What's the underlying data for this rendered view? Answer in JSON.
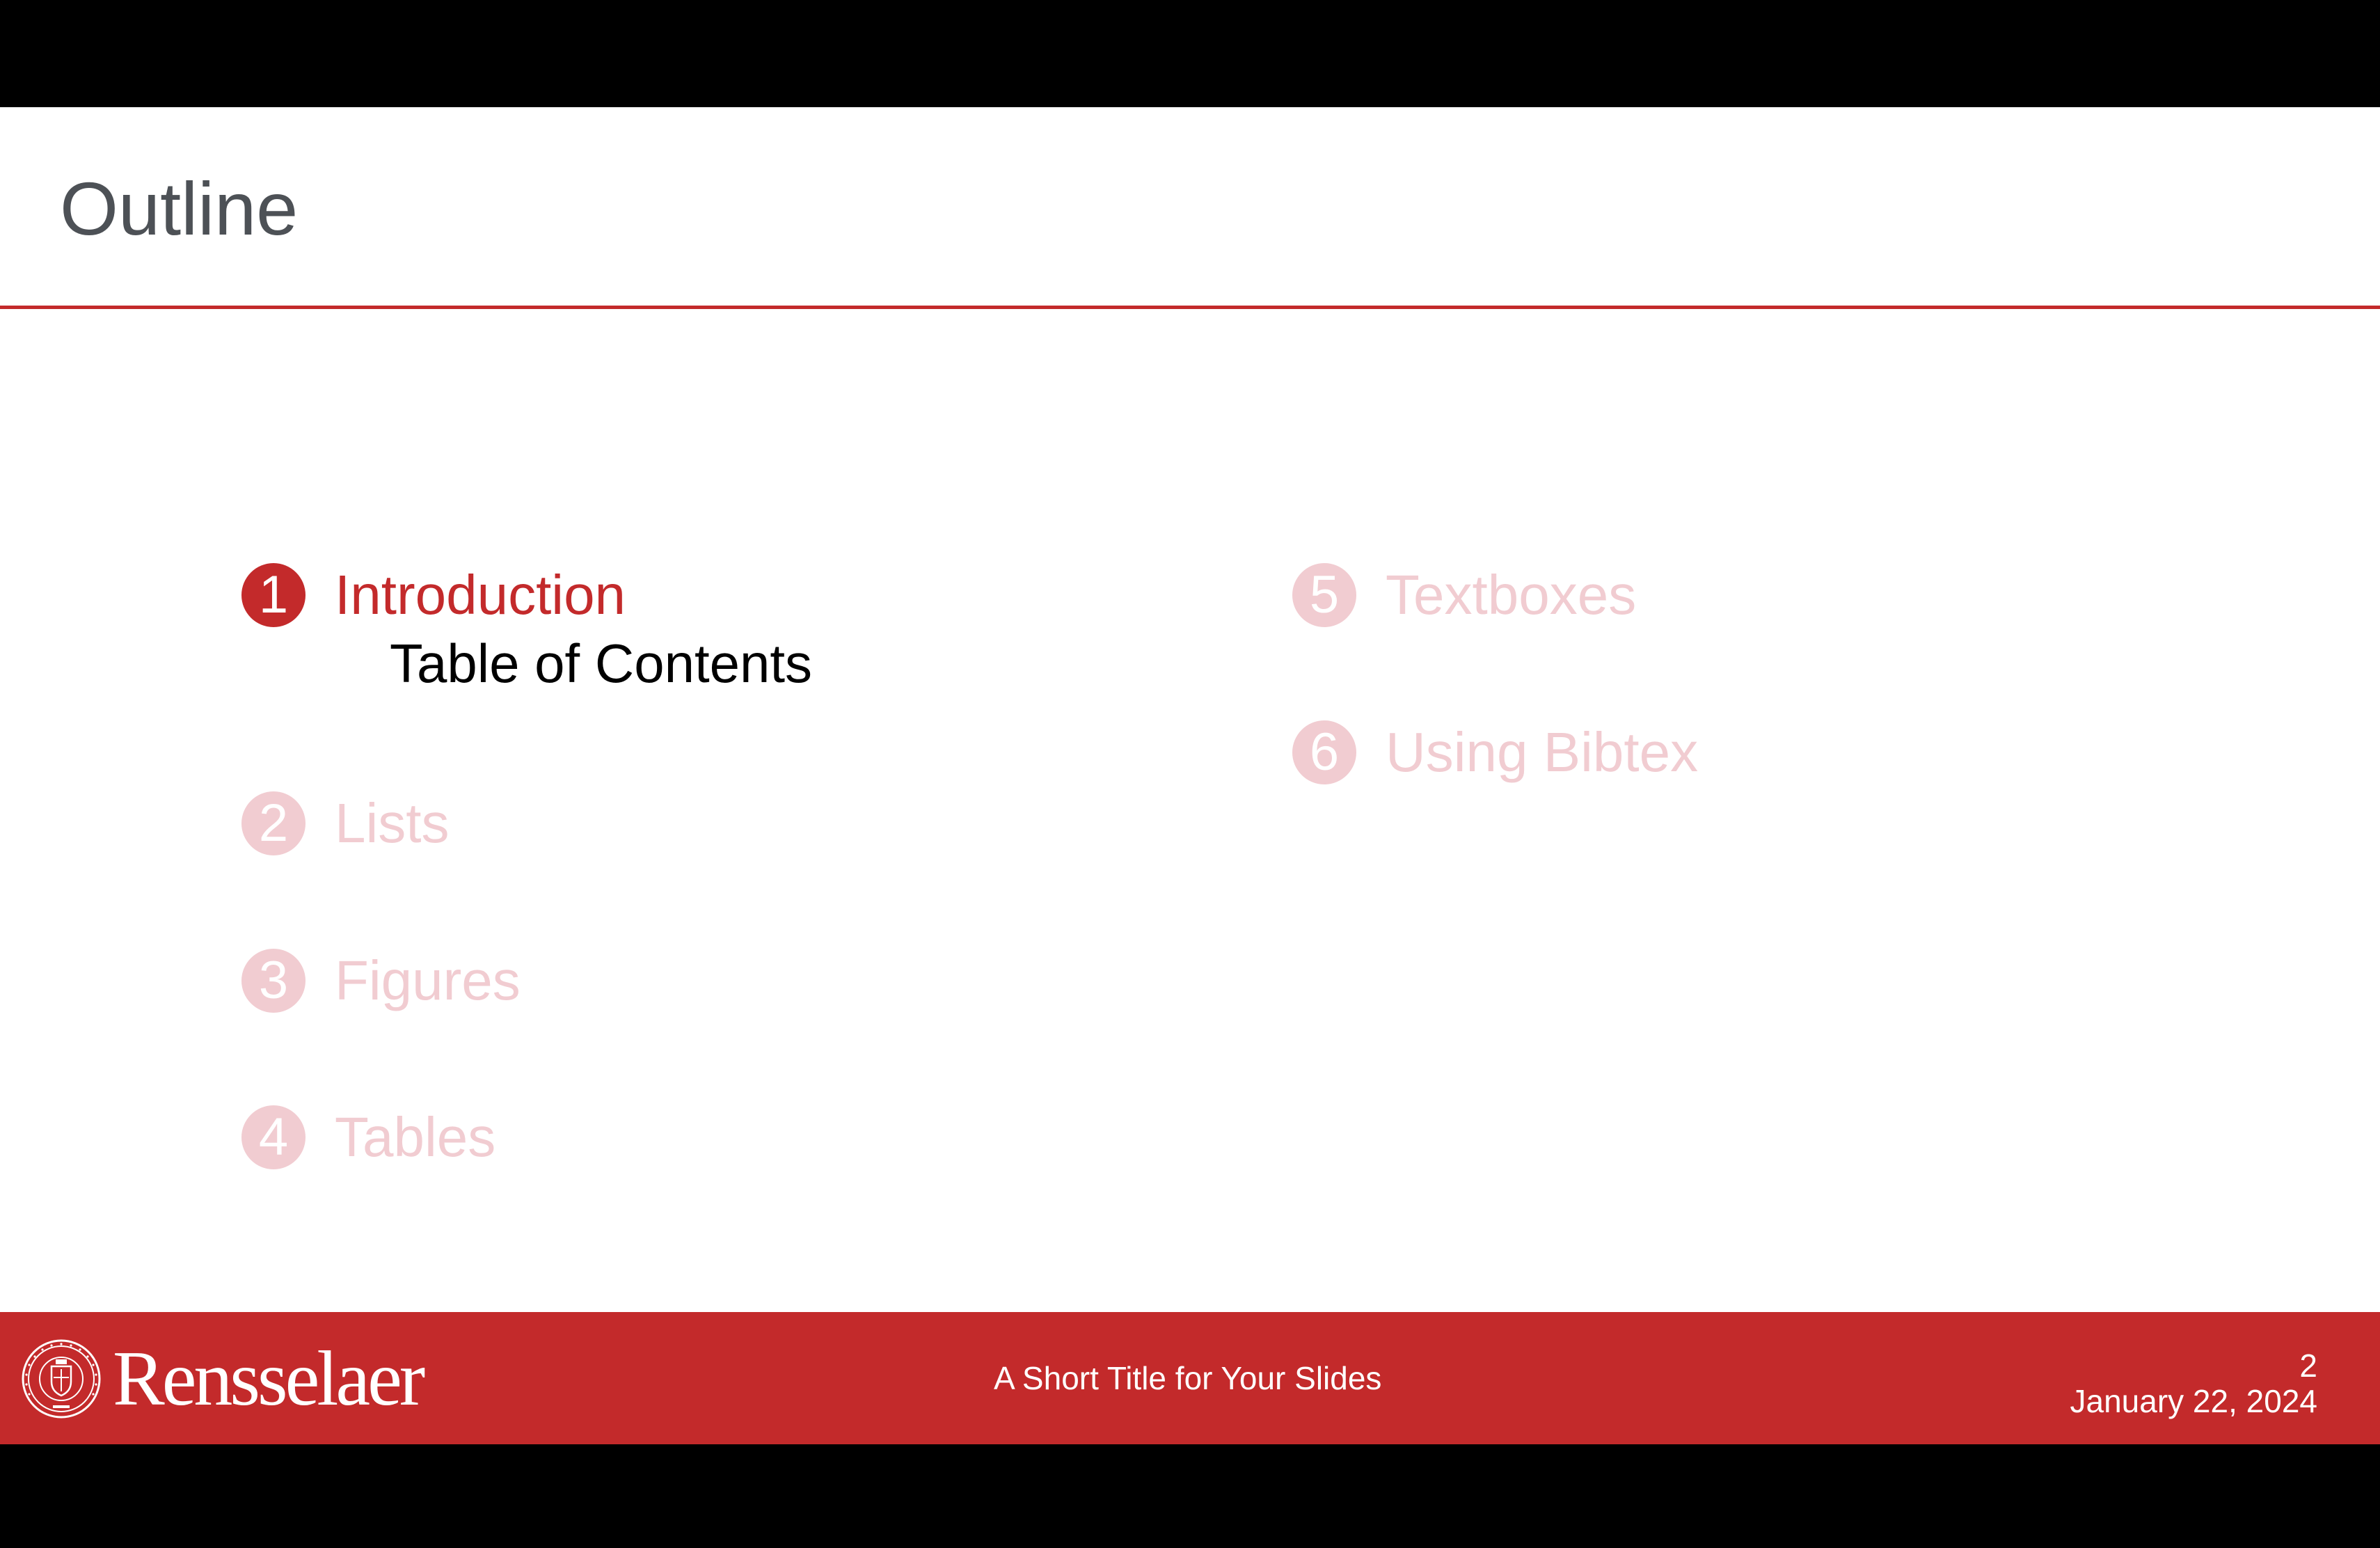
{
  "slide": {
    "title": "Outline",
    "toc": [
      {
        "number": "1",
        "label": "Introduction",
        "state": "active",
        "subsections": [
          "Table of Contents"
        ]
      },
      {
        "number": "2",
        "label": "Lists",
        "state": "faded"
      },
      {
        "number": "3",
        "label": "Figures",
        "state": "faded"
      },
      {
        "number": "4",
        "label": "Tables",
        "state": "faded"
      },
      {
        "number": "5",
        "label": "Textboxes",
        "state": "faded"
      },
      {
        "number": "6",
        "label": "Using Bibtex",
        "state": "faded"
      }
    ]
  },
  "footer": {
    "brand": "Rensselaer",
    "short_title": "A Short Title for Your Slides",
    "page_number": "2",
    "date": "January 22, 2024"
  },
  "colors": {
    "accent": "#c32a2b",
    "faded": "#f1ccd1",
    "title_text": "#4d5156"
  },
  "icons": {
    "seal": "institute-seal-icon"
  }
}
